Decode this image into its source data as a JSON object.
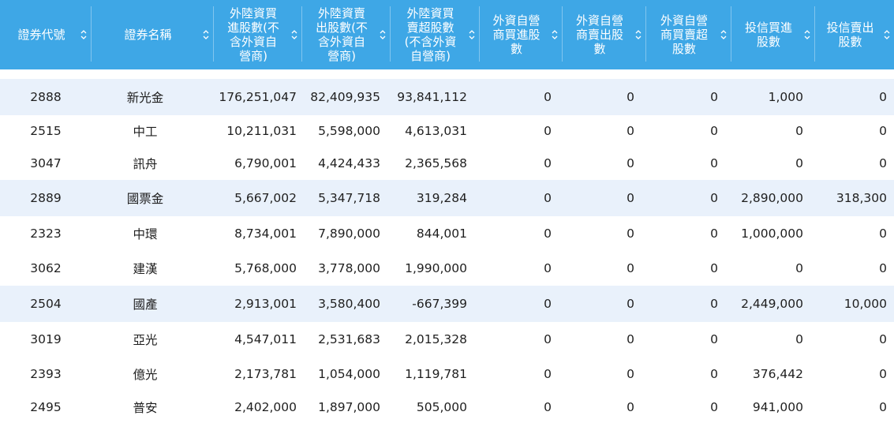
{
  "colors": {
    "header_bg": "#3ea7e6",
    "header_text": "#ffffff",
    "row_shade": "#e9f1fb",
    "row_white": "#ffffff",
    "text": "#1f1f1f"
  },
  "table": {
    "columns": [
      {
        "label": "證券代號"
      },
      {
        "label": "證券名稱"
      },
      {
        "label": "外陸資買\n進股數(不\n含外資自\n營商)"
      },
      {
        "label": "外陸資賣\n出股數(不\n含外資自\n營商)"
      },
      {
        "label": "外陸資買\n賣超股數\n(不含外資\n自營商)"
      },
      {
        "label": "外資自營\n商買進股\n數"
      },
      {
        "label": "外資自營\n商賣出股\n數"
      },
      {
        "label": "外資自營\n商買賣超\n股數"
      },
      {
        "label": "投信買進\n股數"
      },
      {
        "label": "投信賣出\n股數"
      }
    ],
    "rows": [
      {
        "cells": [
          "2888",
          "新光金",
          "176,251,047",
          "82,409,935",
          "93,841,112",
          "0",
          "0",
          "0",
          "1,000",
          "0"
        ]
      },
      {
        "cells": [
          "2515",
          "中工",
          "10,211,031",
          "5,598,000",
          "4,613,031",
          "0",
          "0",
          "0",
          "0",
          "0"
        ]
      },
      {
        "cells": [
          "3047",
          "訊舟",
          "6,790,001",
          "4,424,433",
          "2,365,568",
          "0",
          "0",
          "0",
          "0",
          "0"
        ]
      },
      {
        "cells": [
          "2889",
          "國票金",
          "5,667,002",
          "5,347,718",
          "319,284",
          "0",
          "0",
          "0",
          "2,890,000",
          "318,300"
        ]
      },
      {
        "cells": [
          "2323",
          "中環",
          "8,734,001",
          "7,890,000",
          "844,001",
          "0",
          "0",
          "0",
          "1,000,000",
          "0"
        ]
      },
      {
        "cells": [
          "3062",
          "建漢",
          "5,768,000",
          "3,778,000",
          "1,990,000",
          "0",
          "0",
          "0",
          "0",
          "0"
        ]
      },
      {
        "cells": [
          "2504",
          "國產",
          "2,913,001",
          "3,580,400",
          "-667,399",
          "0",
          "0",
          "0",
          "2,449,000",
          "10,000"
        ]
      },
      {
        "cells": [
          "3019",
          "亞光",
          "4,547,011",
          "2,531,683",
          "2,015,328",
          "0",
          "0",
          "0",
          "0",
          "0"
        ]
      },
      {
        "cells": [
          "2393",
          "億光",
          "2,173,781",
          "1,054,000",
          "1,119,781",
          "0",
          "0",
          "0",
          "376,442",
          "0"
        ]
      },
      {
        "cells": [
          "2495",
          "普安",
          "2,402,000",
          "1,897,000",
          "505,000",
          "0",
          "0",
          "0",
          "941,000",
          "0"
        ]
      }
    ]
  }
}
